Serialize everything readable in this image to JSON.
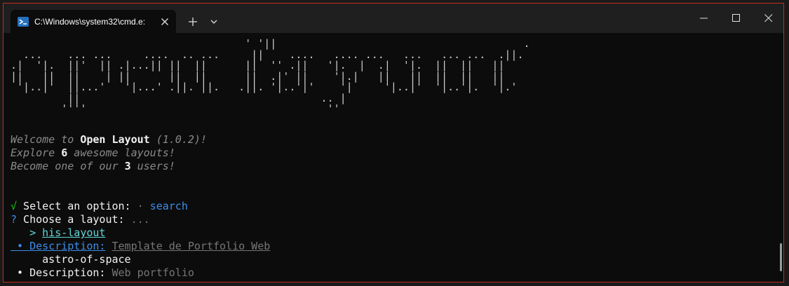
{
  "window": {
    "tab_title": "C:\\Windows\\system32\\cmd.e:",
    "tab_icon": "powershell-icon",
    "colors": {
      "border": "#c42b1c",
      "titlebar": "#1f1f1f",
      "terminal_bg": "#0c0c0c"
    }
  },
  "titlebar": {
    "new_tab_icon": "plus-icon",
    "tab_menu_icon": "chevron-down-icon",
    "minimize_icon": "minimize-icon",
    "maximize_icon": "maximize-icon",
    "close_icon": "close-icon"
  },
  "terminal": {
    "ascii_art": "                                     ' '||                                       .\n  ...    ... ...     ....  .. ...     ||    ....   .... ...   ...   ... ...  .||.\n.|  '|.  ||'  || .|...|| ||  ||      ||  '' .||   '|.  |  .|  '|.  ||  ||   ||\n||   ||  ||    | ||      ||  ||      ||  .|' ||    '|.|   ||   ||  ||  ||   ||\n '|..|'  ||...'   '|...' .||. ||.   .||. '|..'|'    '|     '|..|'  '|..'|.  '|.'\n         ||                                      .. |\n        ''''                                      ''",
    "welcome": {
      "prefix": "Welcome to ",
      "name": "Open Layout",
      "version": " (1.0.2)!"
    },
    "explore": {
      "prefix": "Explore ",
      "count": "6",
      "suffix": " awesome layouts!"
    },
    "become": {
      "prefix": "Become one of our ",
      "count": "3",
      "suffix": " users!"
    },
    "select": {
      "check": "√",
      "label": " Select an option: ",
      "sep": "·",
      "value": "search"
    },
    "choose": {
      "mark": "?",
      "label": " Choose a layout: ",
      "hint": "..."
    },
    "layouts": [
      {
        "name": "his-layout",
        "selected": true,
        "pointer": ">",
        "bullet": "•",
        "desc_label": "Description:",
        "desc_value": "Template de Portfolio Web"
      },
      {
        "name": "astro-of-space",
        "selected": false,
        "bullet": "•",
        "desc_label": "Description:",
        "desc_value": "Web portfolio"
      }
    ]
  }
}
